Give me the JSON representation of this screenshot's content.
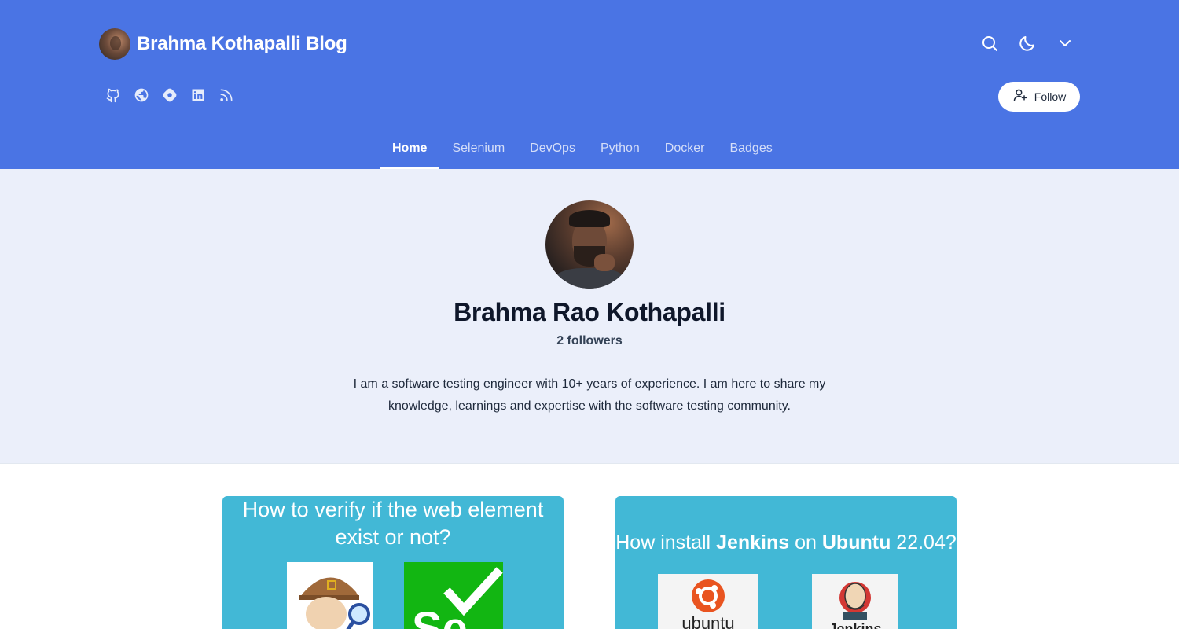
{
  "header": {
    "brand_title": "Brahma Kothapalli Blog",
    "follow_label": "Follow",
    "bg_color": "#4a74e4"
  },
  "icons": {
    "top_actions": [
      "search-icon",
      "moon-icon",
      "chevron-down-icon"
    ],
    "socials": [
      "github-icon",
      "globe-icon",
      "hashnode-icon",
      "linkedin-icon",
      "rss-icon"
    ]
  },
  "nav": {
    "items": [
      {
        "label": "Home",
        "active": true
      },
      {
        "label": "Selenium",
        "active": false
      },
      {
        "label": "DevOps",
        "active": false
      },
      {
        "label": "Python",
        "active": false
      },
      {
        "label": "Docker",
        "active": false
      },
      {
        "label": "Badges",
        "active": false
      }
    ]
  },
  "profile": {
    "name": "Brahma Rao Kothapalli",
    "followers": "2 followers",
    "bio": "I am a software testing engineer with 10+ years of experience. I am here to share my knowledge, learnings and expertise with the software testing community."
  },
  "posts": [
    {
      "cover_title": "How to verify if the web element exist or not?",
      "cover_color": "#42b8d6"
    },
    {
      "cover_title_parts": [
        "How install ",
        "Jenkins",
        " on ",
        "Ubuntu",
        " 22.04?"
      ],
      "logo_texts": [
        "ubuntu",
        "Jenkins"
      ],
      "cover_color": "#42b8d6"
    }
  ]
}
